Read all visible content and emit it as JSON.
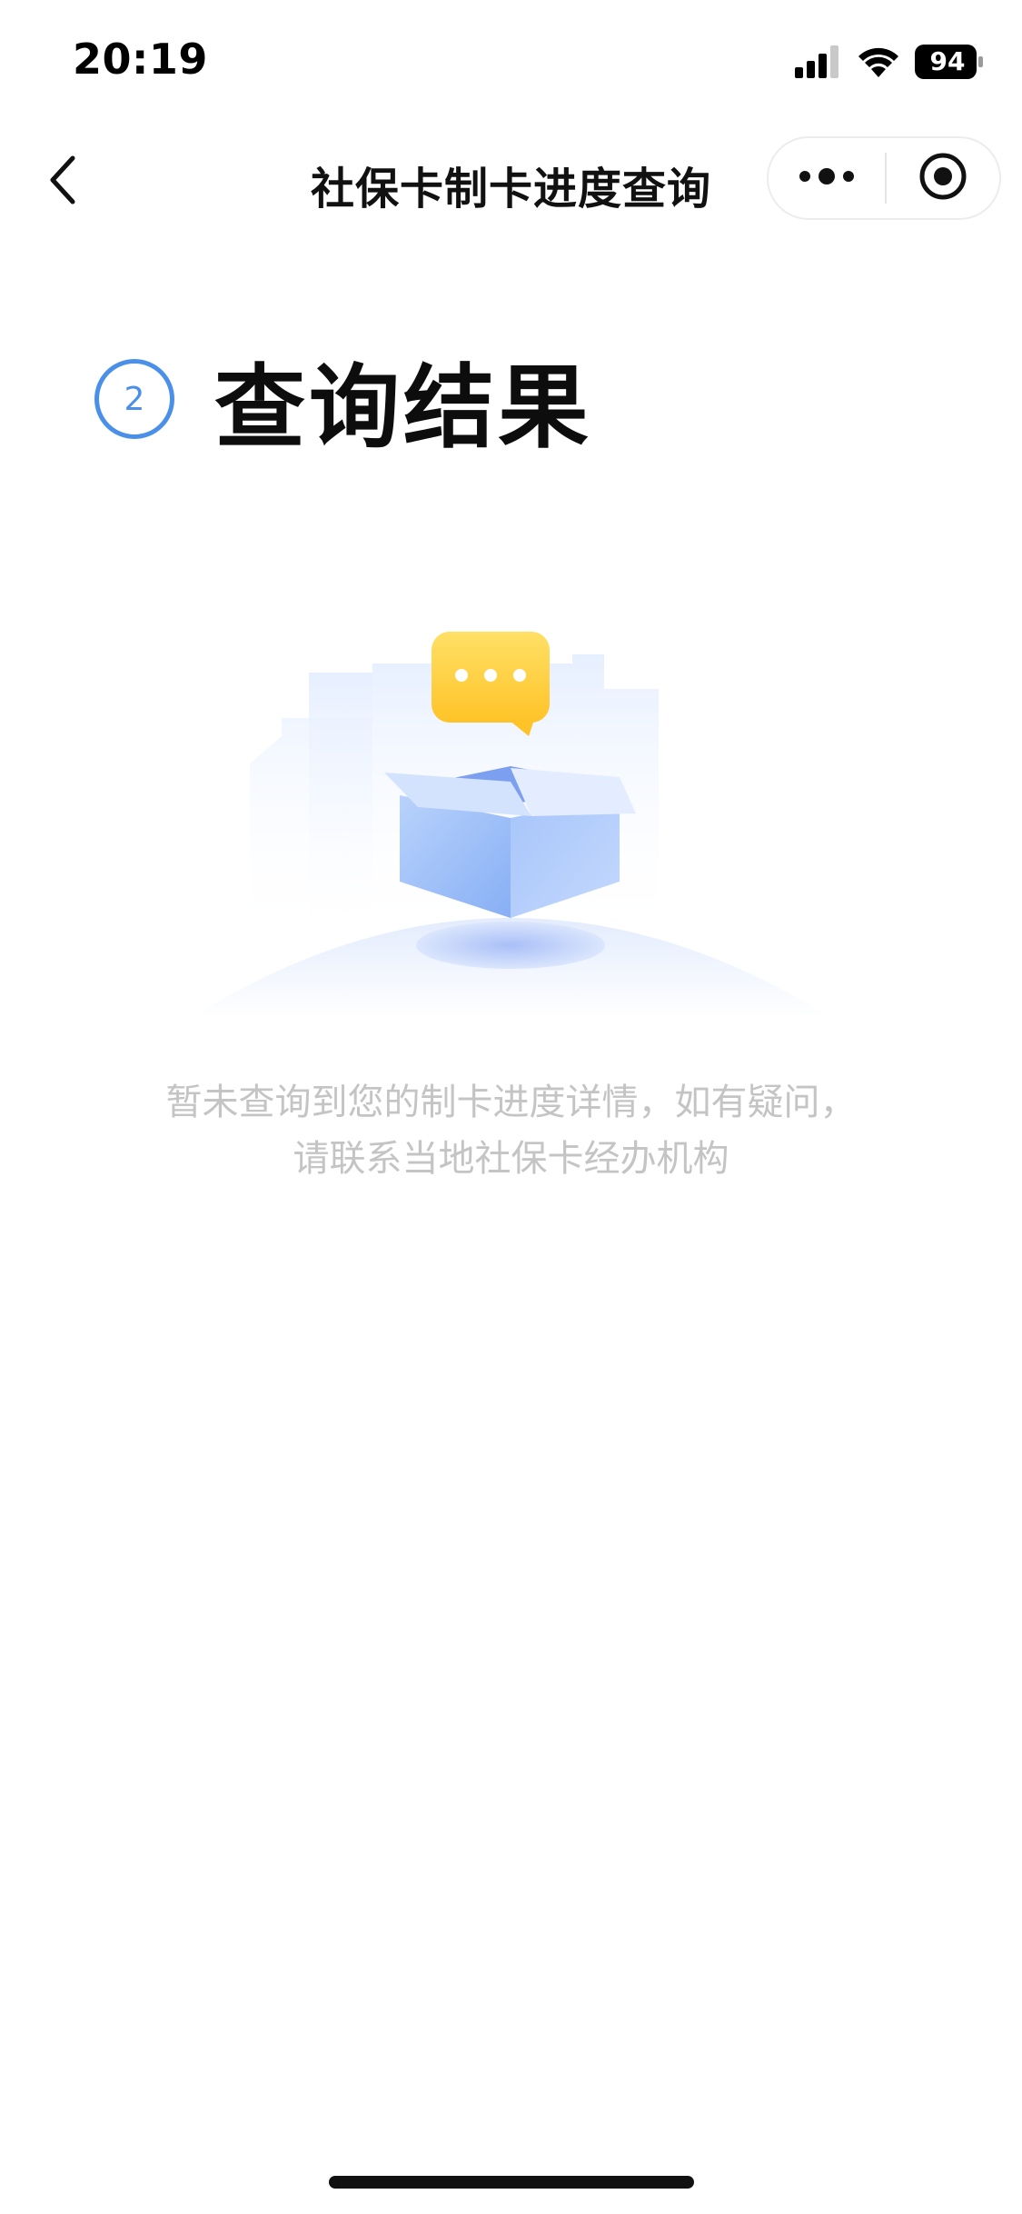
{
  "status_bar": {
    "time": "20:19",
    "battery_level": "94",
    "icons": [
      "signal-icon",
      "wifi-icon",
      "battery-icon"
    ]
  },
  "nav": {
    "back_icon": "chevron-left-icon",
    "title": "社保卡制卡进度查询",
    "more_icon": "more-dots-icon",
    "close_icon": "target-circle-icon"
  },
  "result": {
    "step_number": "2",
    "title": "查询结果"
  },
  "illustration": {
    "icon": "empty-box-icon",
    "bubble_icon": "chat-bubble-icon"
  },
  "empty_message": {
    "line1": "暂未查询到您的制卡进度详情，如有疑问，",
    "line2": "请联系当地社保卡经办机构"
  },
  "colors": {
    "accent": "#4b90e8",
    "title_text": "#111111",
    "hint_text": "#c4c4c4",
    "bubble": "#ffcf3c",
    "box": "#9ec0f8"
  }
}
